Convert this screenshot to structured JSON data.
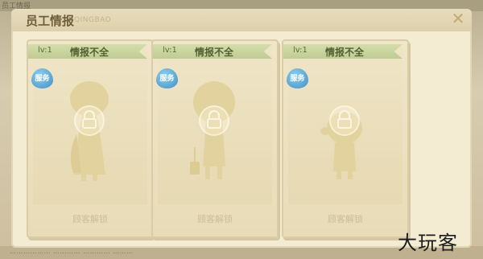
{
  "background": {
    "top_label": "员工情报",
    "bottom_text": "……………… ………… ………… ………"
  },
  "dialog": {
    "title": "员工情报",
    "subtitle": "QINGBAO",
    "close_symbol": "✕"
  },
  "cards": [
    {
      "level": "lv:1",
      "status": "情报不全",
      "badge": "服务",
      "unlock_label": "顾客解锁"
    },
    {
      "level": "lv:1",
      "status": "情报不全",
      "badge": "服务",
      "unlock_label": "顾客解锁"
    },
    {
      "level": "lv:1",
      "status": "情报不全",
      "badge": "服务",
      "unlock_label": "顾客解锁"
    }
  ],
  "watermark": "大玩客",
  "colors": {
    "panel": "#f4ecd2",
    "level_bar": "#c7d39a",
    "badge": "#4b9fd2",
    "silhouette": "#e2d29d"
  }
}
